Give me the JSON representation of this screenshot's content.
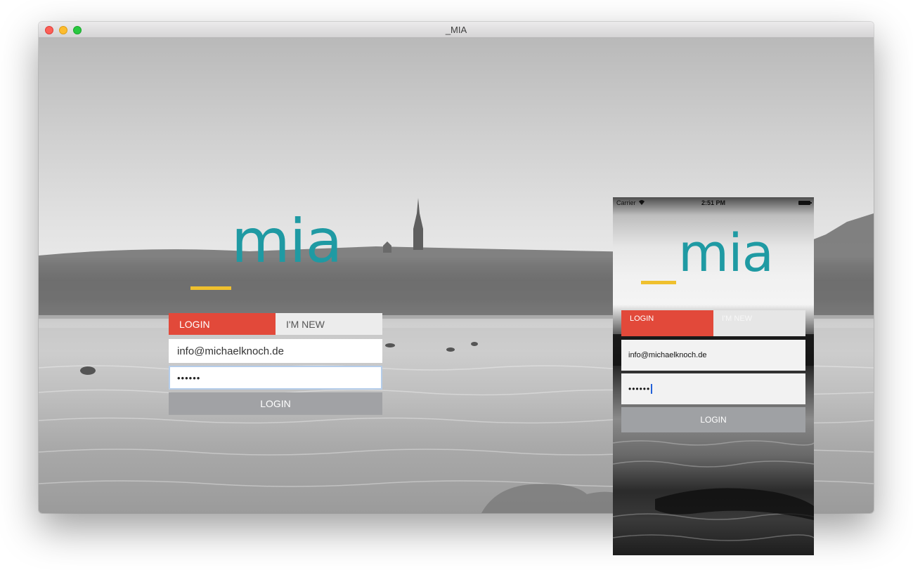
{
  "window": {
    "title": "_MIA"
  },
  "desktop": {
    "logo": "mia",
    "tabs": [
      {
        "label": "LOGIN",
        "active": true
      },
      {
        "label": "I'M NEW",
        "active": false
      }
    ],
    "email_value": "info@michaelknoch.de",
    "password_mask": "••••••",
    "submit_label": "LOGIN"
  },
  "phone": {
    "status": {
      "carrier": "Carrier",
      "time": "2:51 PM"
    },
    "logo": "_mia",
    "tabs": [
      {
        "label": "LOGIN",
        "active": true
      },
      {
        "label": "I'M NEW",
        "active": false
      }
    ],
    "email_value": "info@michaelknoch.de",
    "password_mask": "••••••",
    "submit_label": "LOGIN"
  },
  "colors": {
    "accent_red": "#e2493a",
    "brand_teal": "#1f9aa3",
    "logo_yellow": "#efc02e",
    "button_gray": "#a1a2a5"
  },
  "icons": [
    "close-icon",
    "minimize-icon",
    "maximize-icon",
    "wifi-icon",
    "battery-icon"
  ]
}
